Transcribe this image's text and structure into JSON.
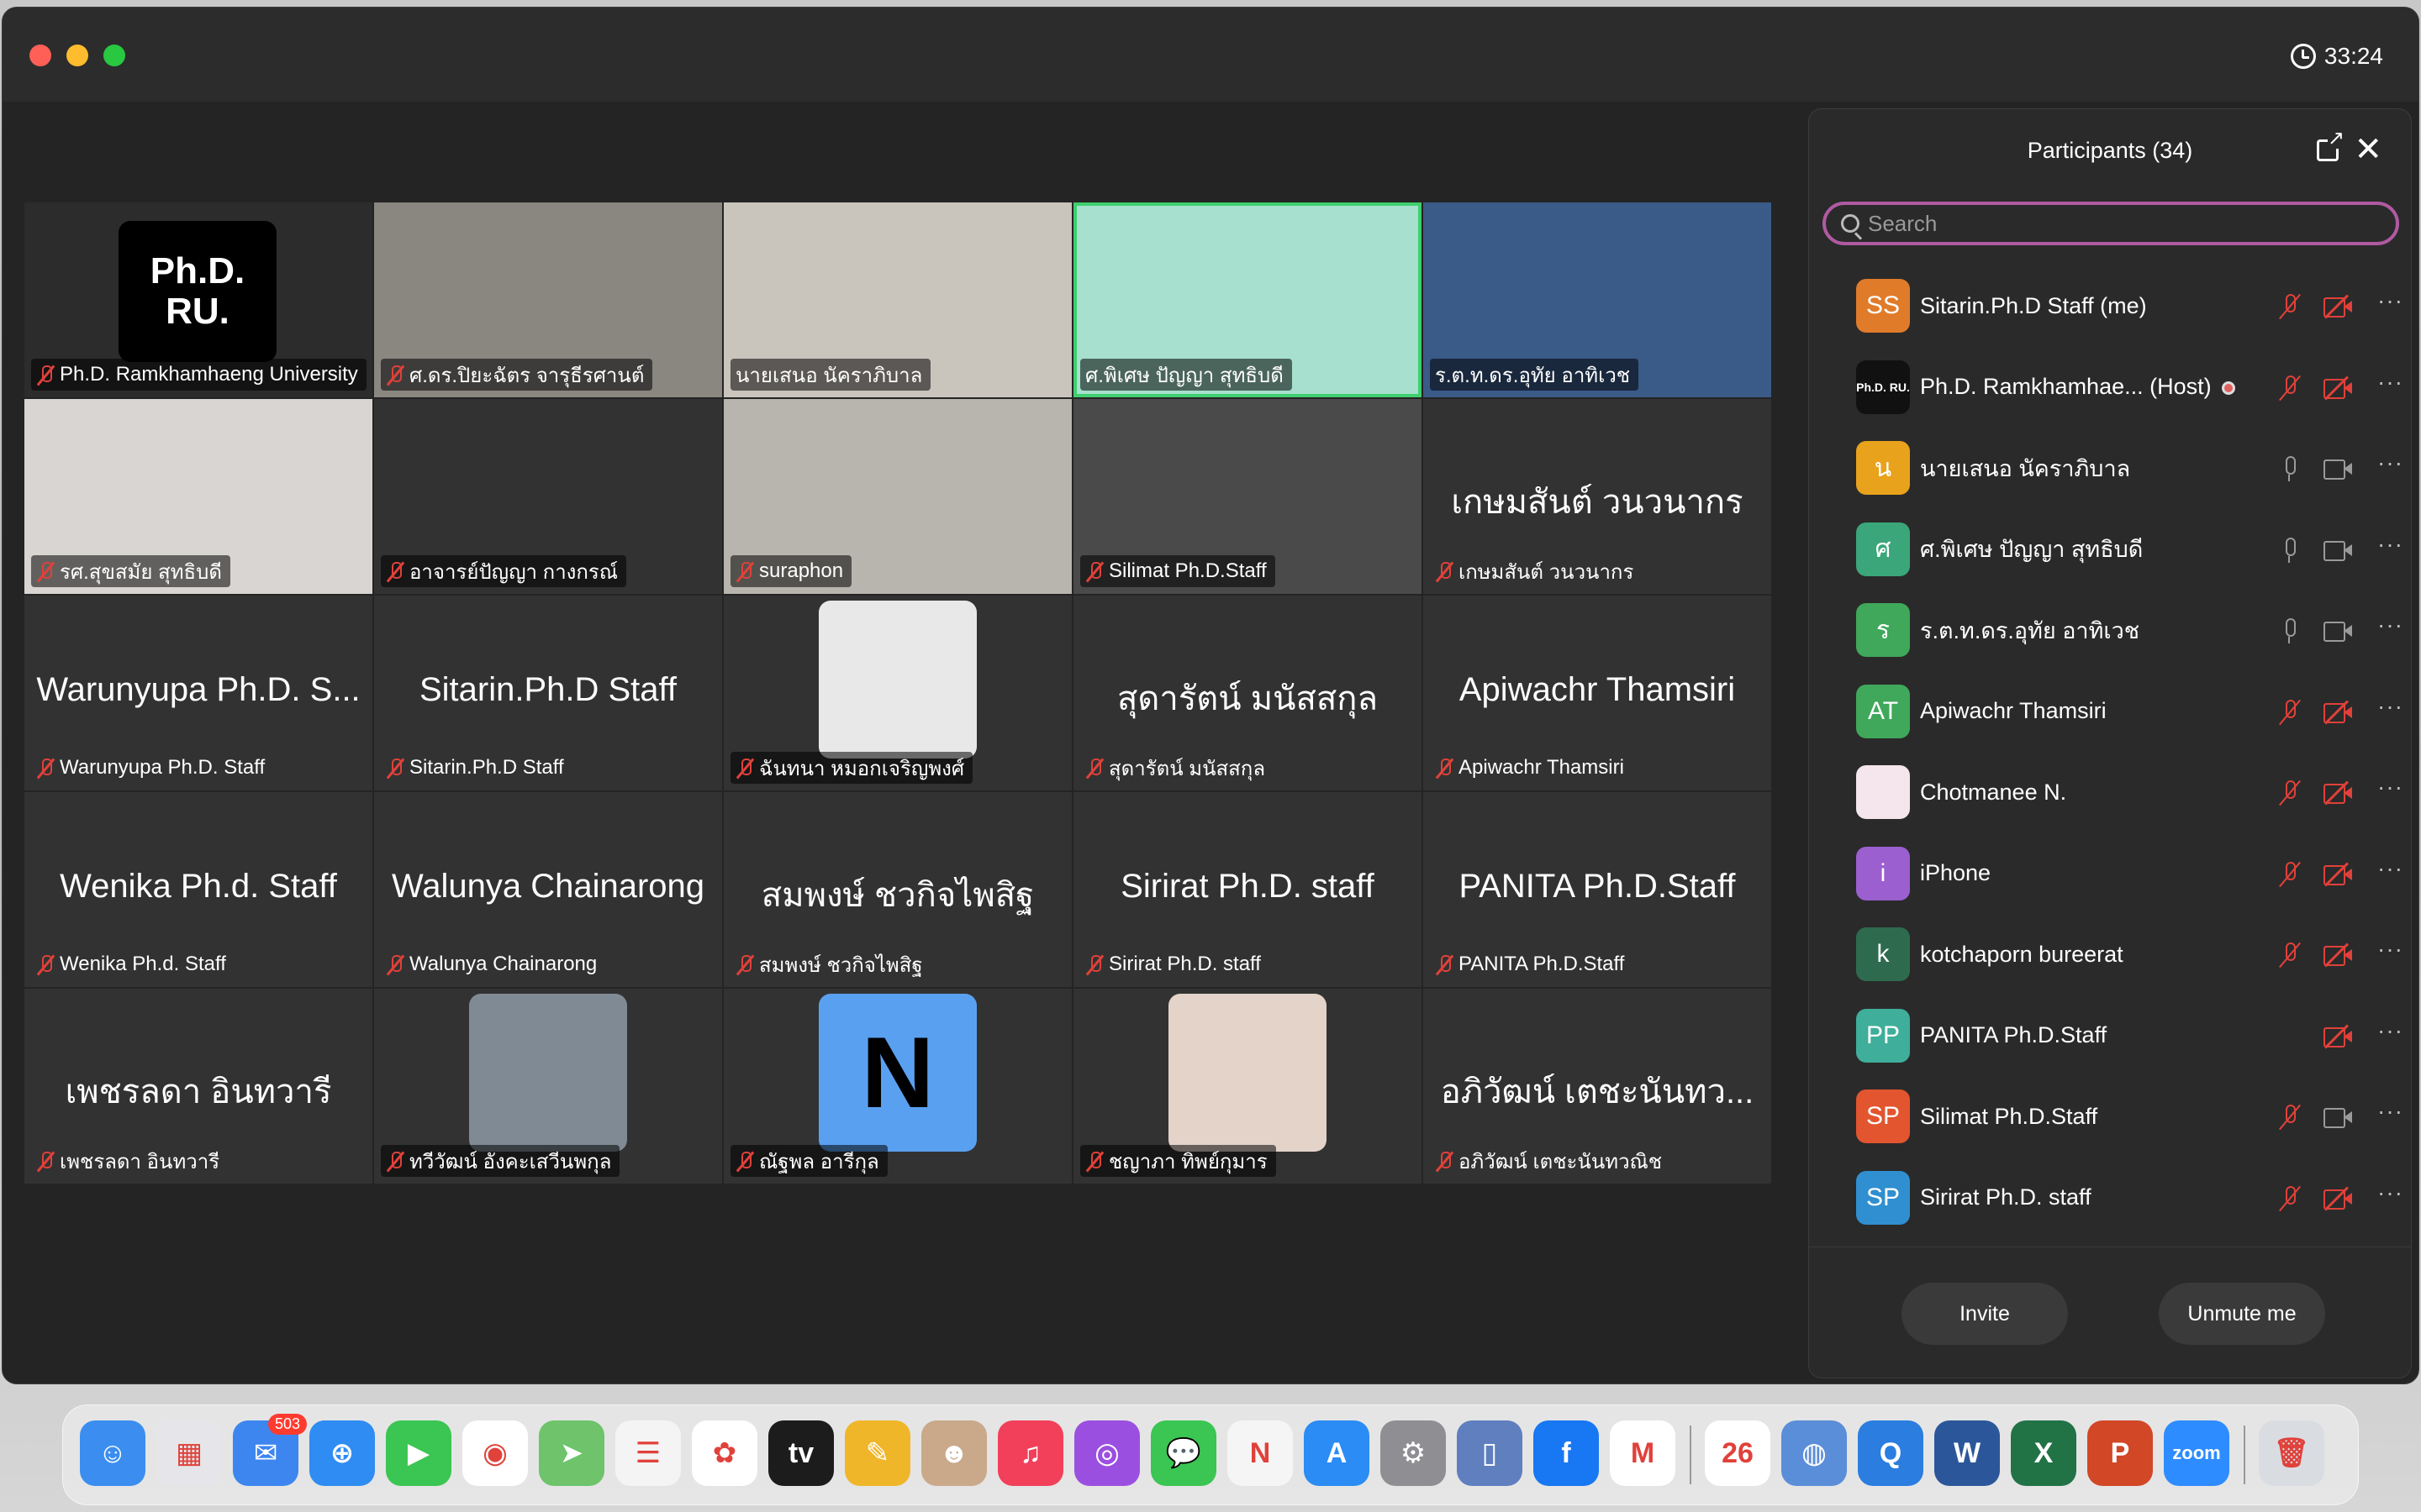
{
  "window": {
    "timer": "33:24"
  },
  "tiles": [
    {
      "label": "Ph.D. Ramkhamhaeng University",
      "big": "",
      "logo": "Ph.D.\nRU.",
      "bg": "#2c2c2c",
      "muted": true
    },
    {
      "label": "ศ.ดร.ปิยะฉัตร จารุธีรศานต์",
      "big": "",
      "bg": "#8a8680",
      "muted": true
    },
    {
      "label": "นายเสนอ นัคราภิบาล",
      "big": "",
      "bg": "#c9c4bc",
      "muted": false
    },
    {
      "label": "ศ.พิเศษ ปัญญา สุทธิบดี",
      "big": "",
      "bg": "#a7e0cf",
      "muted": false,
      "active": true
    },
    {
      "label": "ร.ต.ท.ดร.อุทัย อาทิเวช",
      "big": "",
      "bg": "#3a5a88",
      "muted": false
    },
    {
      "label": "รศ.สุขสมัย สุทธิบดี",
      "big": "",
      "bg": "#d8d5d2",
      "muted": true
    },
    {
      "label": "อาจารย์ปัญญา กางกรณ์",
      "big": "",
      "bg": "#323232",
      "muted": true
    },
    {
      "label": "suraphon",
      "big": "",
      "bg": "#b8b4ae",
      "muted": true
    },
    {
      "label": "Silimat Ph.D.Staff",
      "big": "",
      "bg": "#4a4a4a",
      "muted": true
    },
    {
      "label": "เกษมสันต์ วนวนากร",
      "big": "เกษมสันต์ วนวนากร",
      "bg": "#323232",
      "muted": true
    },
    {
      "label": "Warunyupa Ph.D. Staff",
      "big": "Warunyupa Ph.D. S...",
      "bg": "#323232",
      "muted": true
    },
    {
      "label": "Sitarin.Ph.D Staff",
      "big": "Sitarin.Ph.D Staff",
      "bg": "#323232",
      "muted": true
    },
    {
      "label": "ฉันทนา หมอกเจริญพงศ์",
      "big": "",
      "bg": "#323232",
      "muted": true,
      "avatar": "#e8e8e8"
    },
    {
      "label": "สุดารัตน์ มนัสสกุล",
      "big": "สุดารัตน์ มนัสสกุล",
      "bg": "#323232",
      "muted": true
    },
    {
      "label": "Apiwachr Thamsiri",
      "big": "Apiwachr Thamsiri",
      "bg": "#323232",
      "muted": true
    },
    {
      "label": "Wenika Ph.d. Staff",
      "big": "Wenika Ph.d. Staff",
      "bg": "#323232",
      "muted": true
    },
    {
      "label": "Walunya Chainarong",
      "big": "Walunya Chainarong",
      "bg": "#323232",
      "muted": true
    },
    {
      "label": "สมพงษ์ ชวกิจไพสิฐ",
      "big": "สมพงษ์ ชวกิจไพสิฐ",
      "bg": "#323232",
      "muted": true
    },
    {
      "label": "Sirirat Ph.D. staff",
      "big": "Sirirat Ph.D. staff",
      "bg": "#323232",
      "muted": true
    },
    {
      "label": "PANITA Ph.D.Staff",
      "big": "PANITA Ph.D.Staff",
      "bg": "#323232",
      "muted": true
    },
    {
      "label": "เพชรลดา อินทวารี",
      "big": "เพชรลดา อินทวารี",
      "bg": "#323232",
      "muted": true
    },
    {
      "label": "ทวีวัฒน์ อังคะเสวีนพกุล",
      "big": "",
      "bg": "#323232",
      "muted": true,
      "avatar": "#7f8a94"
    },
    {
      "label": "ณัฐพล อารีกุล",
      "big": "",
      "bg": "#323232",
      "muted": true,
      "avatar": "#5aa0f0",
      "letter": "N"
    },
    {
      "label": "ชญาภา ทิพย์กุมาร",
      "big": "",
      "bg": "#323232",
      "muted": true,
      "avatar": "#e3d3c9"
    },
    {
      "label": "อภิวัฒน์ เตชะนันทวณิช",
      "big": "อภิวัฒน์ เตชะนันทว...",
      "bg": "#323232",
      "muted": true
    }
  ],
  "panel": {
    "title": "Participants (34)",
    "search_placeholder": "Search",
    "participants": [
      {
        "initials": "SS",
        "color": "#e07b2a",
        "name": "Sitarin.Ph.D Staff (me)",
        "mic": "off",
        "cam": "off"
      },
      {
        "initials": "Ph.D. RU.",
        "color": "#111111",
        "name": "Ph.D. Ramkhamhae...  (Host)",
        "mic": "off",
        "cam": "off",
        "host": true
      },
      {
        "initials": "น",
        "color": "#e8a21c",
        "name": "นายเสนอ นัคราภิบาล",
        "mic": "on",
        "cam": "on"
      },
      {
        "initials": "ศ",
        "color": "#3aa67a",
        "name": "ศ.พิเศษ ปัญญา สุทธิบดี",
        "mic": "on",
        "cam": "on"
      },
      {
        "initials": "ร",
        "color": "#3fa85a",
        "name": "ร.ต.ท.ดร.อุทัย อาทิเวช",
        "mic": "on",
        "cam": "on"
      },
      {
        "initials": "AT",
        "color": "#3fa85a",
        "name": "Apiwachr Thamsiri",
        "mic": "off",
        "cam": "off"
      },
      {
        "initials": "",
        "color": "#f4e6ec",
        "name": "Chotmanee N.",
        "mic": "off",
        "cam": "off"
      },
      {
        "initials": "i",
        "color": "#9b5fd0",
        "name": "iPhone",
        "mic": "off",
        "cam": "off"
      },
      {
        "initials": "k",
        "color": "#2e6b4e",
        "name": "kotchaporn bureerat",
        "mic": "off",
        "cam": "off"
      },
      {
        "initials": "PP",
        "color": "#3fae9a",
        "name": "PANITA Ph.D.Staff",
        "mic": "none",
        "cam": "off"
      },
      {
        "initials": "SP",
        "color": "#e2552e",
        "name": "Silimat Ph.D.Staff",
        "mic": "off",
        "cam": "on"
      },
      {
        "initials": "SP",
        "color": "#2f8fd0",
        "name": "Sirirat Ph.D. staff",
        "mic": "off",
        "cam": "off"
      }
    ],
    "invite_label": "Invite",
    "unmute_label": "Unmute me"
  },
  "dock": [
    {
      "name": "finder-icon",
      "color": "#3b8ef0",
      "glyph": "☺"
    },
    {
      "name": "launchpad-icon",
      "color": "#e6e6ea",
      "glyph": "▦"
    },
    {
      "name": "mail-icon",
      "color": "#3d86f0",
      "glyph": "✉",
      "badge": "503"
    },
    {
      "name": "safari-icon",
      "color": "#2f8cf2",
      "glyph": "⊕"
    },
    {
      "name": "facetime-icon",
      "color": "#3bc552",
      "glyph": "▶"
    },
    {
      "name": "chrome-icon",
      "color": "#ffffff",
      "glyph": "◉"
    },
    {
      "name": "maps-icon",
      "color": "#6ec36b",
      "glyph": "➤"
    },
    {
      "name": "reminders-icon",
      "color": "#f4f4f4",
      "glyph": "☰"
    },
    {
      "name": "photos-icon",
      "color": "#ffffff",
      "glyph": "✿"
    },
    {
      "name": "appletv-icon",
      "color": "#1c1c1c",
      "glyph": "tv"
    },
    {
      "name": "notes-app-icon",
      "color": "#f0b62a",
      "glyph": "✎"
    },
    {
      "name": "contacts-icon",
      "color": "#c9a98a",
      "glyph": "☻"
    },
    {
      "name": "music-icon",
      "color": "#f2405a",
      "glyph": "♫"
    },
    {
      "name": "podcasts-icon",
      "color": "#9b4fe0",
      "glyph": "◎"
    },
    {
      "name": "messages-icon",
      "color": "#3bc552",
      "glyph": "💬"
    },
    {
      "name": "news-icon",
      "color": "#f5f5f5",
      "glyph": "N"
    },
    {
      "name": "appstore-icon",
      "color": "#2a8cf4",
      "glyph": "A"
    },
    {
      "name": "settings-icon",
      "color": "#8e8e93",
      "glyph": "⚙"
    },
    {
      "name": "iphone-mirroring-icon",
      "color": "#5f7fbf",
      "glyph": "▯"
    },
    {
      "name": "facebook-icon",
      "color": "#1877f2",
      "glyph": "f"
    },
    {
      "name": "gmail-icon",
      "color": "#ffffff",
      "glyph": "M"
    },
    {
      "name": "calendar-icon",
      "color": "#ffffff",
      "glyph": "26"
    },
    {
      "name": "camera-app-icon",
      "color": "#5b8ed8",
      "glyph": "◍"
    },
    {
      "name": "quicktime-icon",
      "color": "#2b7de0",
      "glyph": "Q"
    },
    {
      "name": "word-icon",
      "color": "#2b579a",
      "glyph": "W"
    },
    {
      "name": "excel-icon",
      "color": "#217346",
      "glyph": "X"
    },
    {
      "name": "powerpoint-icon",
      "color": "#d24726",
      "glyph": "P"
    },
    {
      "name": "zoom-icon",
      "color": "#2d8cff",
      "glyph": "zoom"
    },
    {
      "name": "trash-icon",
      "color": "#d9dde2",
      "glyph": "🗑"
    }
  ]
}
